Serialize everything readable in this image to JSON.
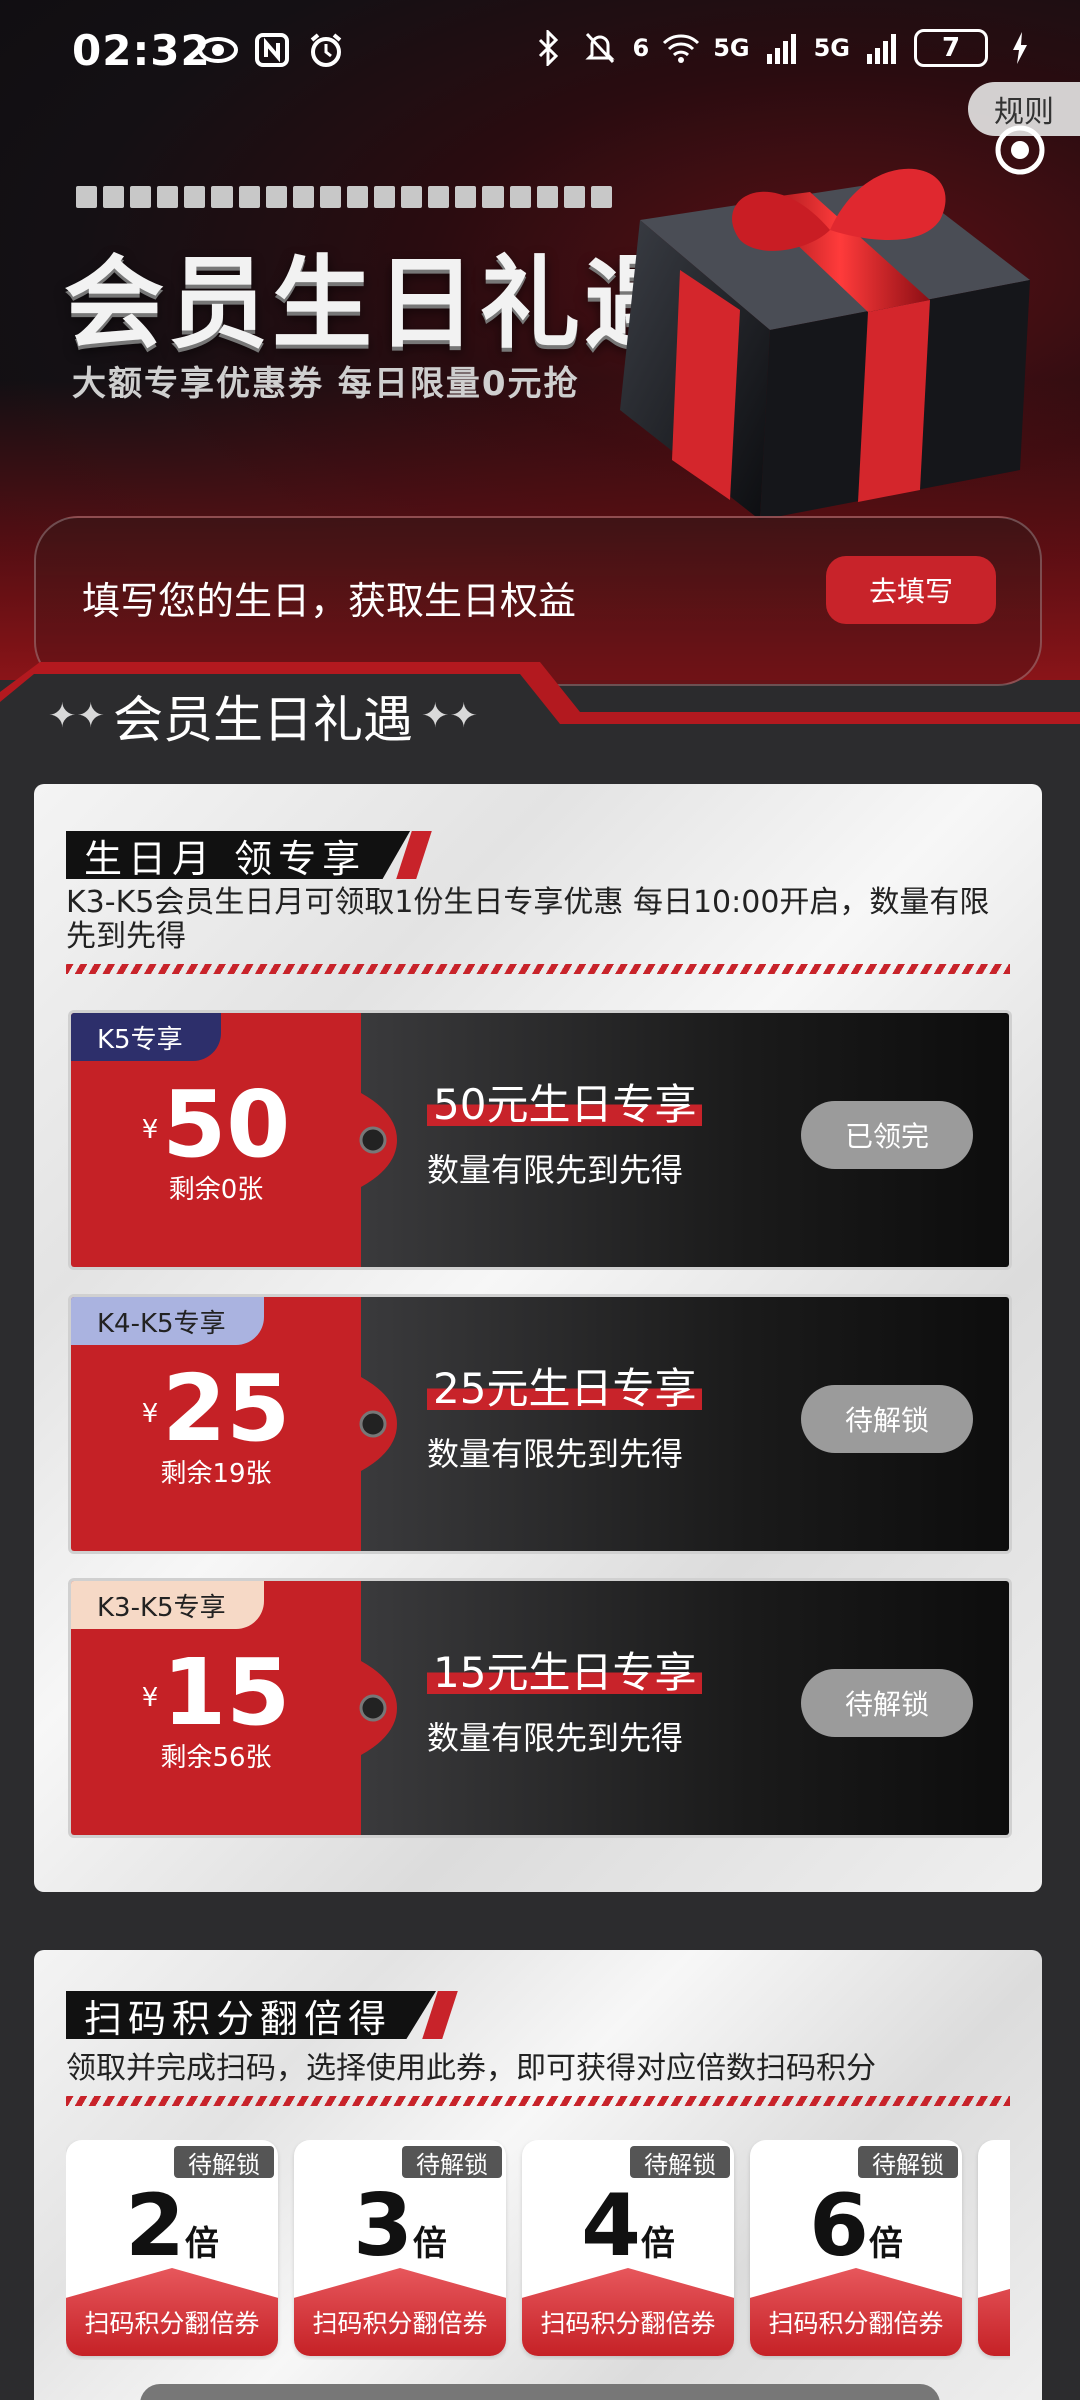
{
  "status_bar": {
    "time": "02:32",
    "icons_left": [
      "eye-icon",
      "nfc-icon",
      "alarm-icon"
    ],
    "network_labels": [
      "6",
      "5G",
      "5G"
    ],
    "battery": "7"
  },
  "rules_label": "规则",
  "hero": {
    "title": "会员生日礼遇",
    "subtitle": "大额专享优惠券 每日限量0元抢"
  },
  "birthday_prompt": {
    "text": "填写您的生日，获取生日权益",
    "button": "去填写"
  },
  "section_title": "会员生日礼遇",
  "birthday_month": {
    "heading": "生日月 领专享",
    "description": "K3-K5会员生日月可领取1份生日专享优惠 每日10:00开启，数量有限先到先得",
    "coupons": [
      {
        "tag": "K5专享",
        "currency": "¥",
        "amount": "50",
        "remaining": "剩余0张",
        "title": "50元生日专享",
        "subtitle": "数量有限先到先得",
        "button": "已领完"
      },
      {
        "tag": "K4-K5专享",
        "currency": "¥",
        "amount": "25",
        "remaining": "剩余19张",
        "title": "25元生日专享",
        "subtitle": "数量有限先到先得",
        "button": "待解锁"
      },
      {
        "tag": "K3-K5专享",
        "currency": "¥",
        "amount": "15",
        "remaining": "剩余56张",
        "title": "15元生日专享",
        "subtitle": "数量有限先到先得",
        "button": "待解锁"
      }
    ]
  },
  "scan_points": {
    "heading": "扫码积分翻倍得",
    "description": "领取并完成扫码，选择使用此券，即可获得对应倍数扫码积分",
    "tiles": [
      {
        "badge": "待解锁",
        "multiplier": "2",
        "unit": "倍",
        "label": "扫码积分翻倍券"
      },
      {
        "badge": "待解锁",
        "multiplier": "3",
        "unit": "倍",
        "label": "扫码积分翻倍券"
      },
      {
        "badge": "待解锁",
        "multiplier": "4",
        "unit": "倍",
        "label": "扫码积分翻倍券"
      },
      {
        "badge": "待解锁",
        "multiplier": "6",
        "unit": "倍",
        "label": "扫码积分翻倍券"
      }
    ]
  },
  "colors": {
    "accent_red": "#c8232a",
    "coupon_red": "#c52126",
    "dark_bg": "#2c2c2e",
    "disabled_button": "#9b9b9b"
  }
}
